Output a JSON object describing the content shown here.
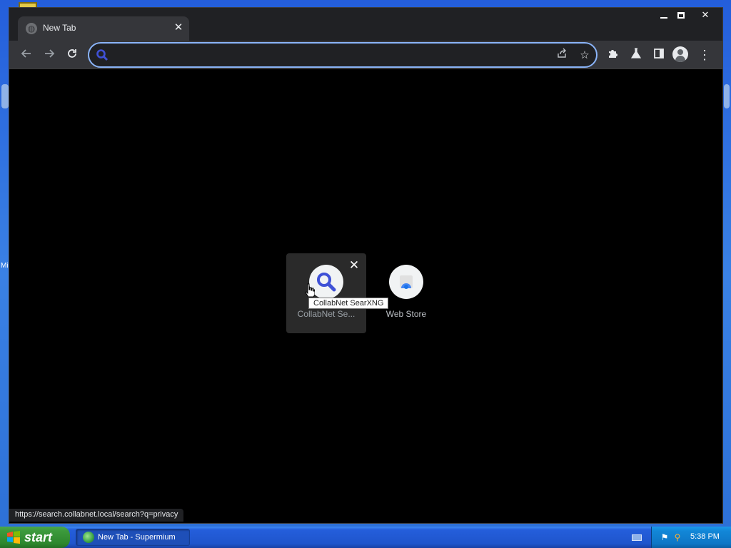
{
  "browser": {
    "tab_title": "New Tab",
    "omnibox_value": "",
    "status_url": "https://search.collabnet.local/search?q=privacy"
  },
  "shortcuts": [
    {
      "label": "CollabNet Se...",
      "tooltip": "CollabNet SearXNG",
      "icon": "search-icon"
    },
    {
      "label": "Web Store",
      "icon": "web-store-icon"
    }
  ],
  "desktop": {
    "partial_icon_label": "Mi"
  },
  "taskbar": {
    "start_label": "start",
    "window_label": "New Tab - Supermium",
    "clock": "5:38 PM"
  },
  "colors": {
    "accent": "#8ab4f8",
    "search_icon": "#3f51d6",
    "page_bg": "#000000"
  }
}
